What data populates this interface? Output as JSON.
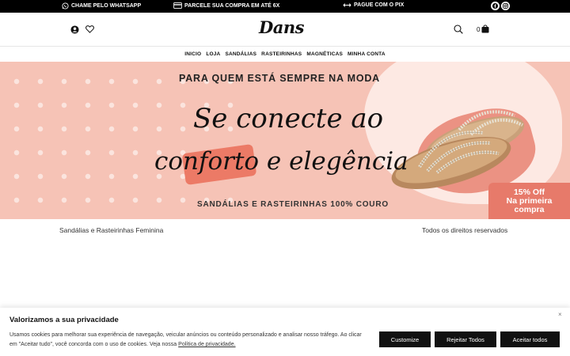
{
  "topbar": {
    "whatsapp": "CHAME PELO WHATSAPP",
    "installments": "PARCELE SUA COMPRA EM ATÉ 6X",
    "pix": "PAGUE COM O PIX"
  },
  "header": {
    "logo": "Dans",
    "cart_count": "0"
  },
  "nav": {
    "items": [
      "INICIO",
      "LOJA",
      "SANDÁLIAS",
      "RASTEIRINHAS",
      "MAGNÉTICAS",
      "MINHA CONTA"
    ]
  },
  "banner": {
    "kicker": "PARA QUEM ESTÁ SEMPRE NA MODA",
    "headline_line1": "Se conecte ao",
    "headline_line2": "conforto e elegência",
    "subline": "SANDÁLIAS E RASTEIRINHAS 100% COURO",
    "offer_line1": "15% Off",
    "offer_line2": "Na primeira",
    "offer_line3": "compra",
    "colors": {
      "background": "#f6c3b6",
      "accent": "#e77a6a"
    }
  },
  "footer": {
    "left": "Sandálias e Rasteirinhas Feminina",
    "right": "Todos os direitos reservados"
  },
  "cookie": {
    "title": "Valorizamos a sua privacidade",
    "text": "Usamos cookies para melhorar sua experiência de navegação, veicular anúncios ou conteúdo personalizado e analisar nosso tráfego. Ao clicar em \"Aceitar tudo\", você concorda com o uso de cookies. Veja nossa",
    "policy_link": "Política de privacidade.",
    "close": "×",
    "customize": "Customize",
    "reject": "Rejeitar Todos",
    "accept": "Aceitar todos"
  }
}
